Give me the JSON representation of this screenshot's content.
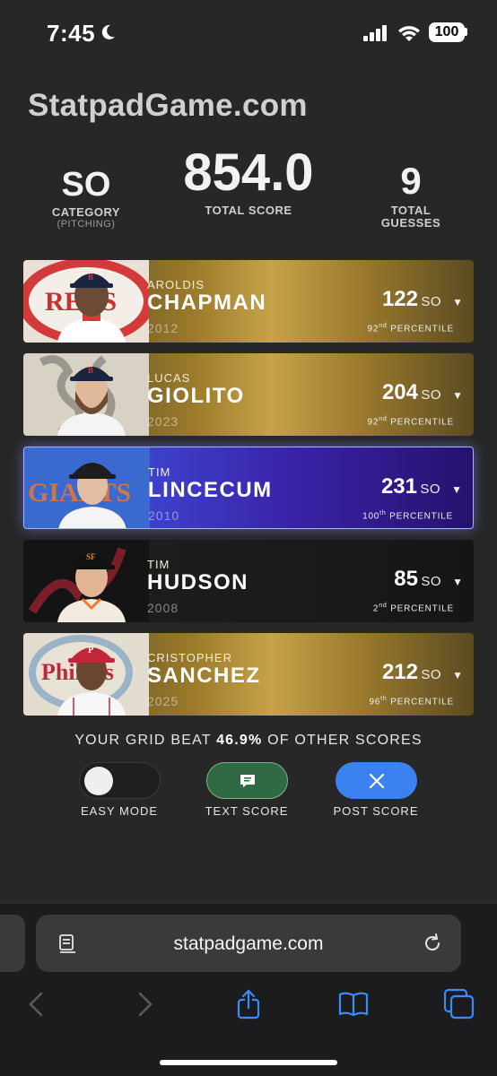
{
  "status_bar": {
    "time": "7:45",
    "battery": "100"
  },
  "site_title": "StatpadGame.com",
  "summary": {
    "category_value": "SO",
    "category_label": "CATEGORY",
    "category_sub": "(PITCHING)",
    "total_score_value": "854.0",
    "total_score_label": "TOTAL SCORE",
    "guesses_value": "9",
    "guesses_label_1": "TOTAL",
    "guesses_label_2": "GUESSES"
  },
  "players": [
    {
      "first": "AROLDIS",
      "last": "CHAPMAN",
      "year": "2012",
      "score": "122",
      "unit": "SO",
      "pct_num": "92",
      "pct_suffix": "nd",
      "pct_label": " PERCENTILE",
      "style": "gold",
      "logo": "reds-logo",
      "cap": "red-sox-cap"
    },
    {
      "first": "LUCAS",
      "last": "GIOLITO",
      "year": "2023",
      "score": "204",
      "unit": "SO",
      "pct_num": "92",
      "pct_suffix": "nd",
      "pct_label": " PERCENTILE",
      "style": "gold",
      "logo": "white-sox-logo",
      "cap": "red-sox-cap"
    },
    {
      "first": "TIM",
      "last": "LINCECUM",
      "year": "2010",
      "score": "231",
      "unit": "SO",
      "pct_num": "100",
      "pct_suffix": "th",
      "pct_label": " PERCENTILE",
      "style": "purple",
      "logo": "giants-logo",
      "cap": "giants-cap"
    },
    {
      "first": "TIM",
      "last": "HUDSON",
      "year": "2008",
      "score": "85",
      "unit": "SO",
      "pct_num": "2",
      "pct_suffix": "nd",
      "pct_label": " PERCENTILE",
      "style": "dark",
      "logo": "braves-logo",
      "cap": "giants-cap"
    },
    {
      "first": "CRISTOPHER",
      "last": "SANCHEZ",
      "year": "2025",
      "score": "212",
      "unit": "SO",
      "pct_num": "96",
      "pct_suffix": "th",
      "pct_label": " PERCENTILE",
      "style": "gold",
      "logo": "phillies-logo",
      "cap": "phillies-cap"
    }
  ],
  "beat": {
    "prefix": "YOUR GRID BEAT ",
    "value": "46.9%",
    "suffix": " OF OTHER SCORES"
  },
  "actions": {
    "easy_mode": "EASY MODE",
    "text_score": "TEXT SCORE",
    "post_score": "POST SCORE"
  },
  "browser": {
    "url": "statpadgame.com"
  },
  "colors": {
    "background": "#272727",
    "gold": "#c6a24a",
    "purple": "#3a22a8",
    "text_button": "#2f6a45",
    "post_button": "#3b82f0"
  }
}
